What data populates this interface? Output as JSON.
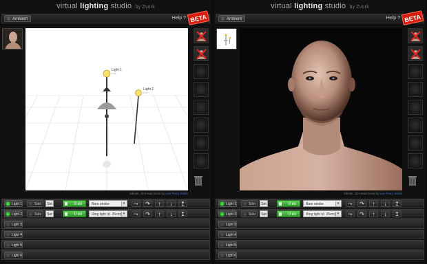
{
  "app": {
    "title_light": "virtual",
    "title_bold": "lighting",
    "title_tail": "studio",
    "by": "by Zvork"
  },
  "ambient_label": "Ambient",
  "help_label": "Help ?",
  "beta_label": "BETA",
  "scene": {
    "light1_label": "Light 1",
    "light1_ev": "0 ev",
    "light2_label": "Light 2",
    "light2_ev": "0 ev"
  },
  "credit_prefix": "Infinite, 3D Head Scan by",
  "credit_link": "Lee Perry-Smith",
  "rows": [
    {
      "label": "Light 1",
      "active": true,
      "solo": "Solo",
      "sel": "Set",
      "ev": "0 ev",
      "modifier": "Bare strobe"
    },
    {
      "label": "Light 2",
      "active": true,
      "solo": "Solo",
      "sel": "Set",
      "ev": "0 ev",
      "modifier": "Ring light (d. 25cm)"
    },
    {
      "label": "Light 3"
    },
    {
      "label": "Light 4"
    },
    {
      "label": "Light 5"
    },
    {
      "label": "Light 6"
    }
  ],
  "colors": {
    "led_on": "#35e02d",
    "ev_green": "#3fb83a",
    "beta_red": "#d81d0f",
    "link": "#4a6fd6"
  },
  "icons": [
    "move-icon",
    "rotate-icon",
    "arrow-up-icon",
    "arrow-down-icon",
    "aim-icon",
    "trash-icon",
    "light-source-off-icon",
    "light-slot-icon"
  ]
}
